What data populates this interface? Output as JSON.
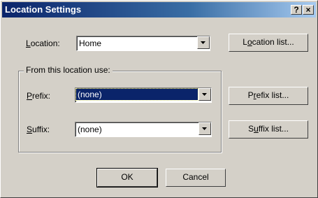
{
  "window": {
    "title": "Location Settings",
    "help_label": "?",
    "close_label": "×"
  },
  "location": {
    "label_accel": "L",
    "label_rest": "ocation:",
    "value": "Home",
    "list_button_pre": "L",
    "list_button_accel": "o",
    "list_button_rest": "cation list..."
  },
  "group": {
    "legend": "From this location use:"
  },
  "prefix": {
    "label_accel": "P",
    "label_rest": "refix:",
    "value": "(none)",
    "list_button_pre": "P",
    "list_button_accel": "r",
    "list_button_rest": "efix list..."
  },
  "suffix": {
    "label_accel": "S",
    "label_rest": "uffix:",
    "value": "(none)",
    "list_button_pre": "S",
    "list_button_accel": "u",
    "list_button_rest": "ffix list..."
  },
  "buttons": {
    "ok": "OK",
    "cancel": "Cancel"
  }
}
